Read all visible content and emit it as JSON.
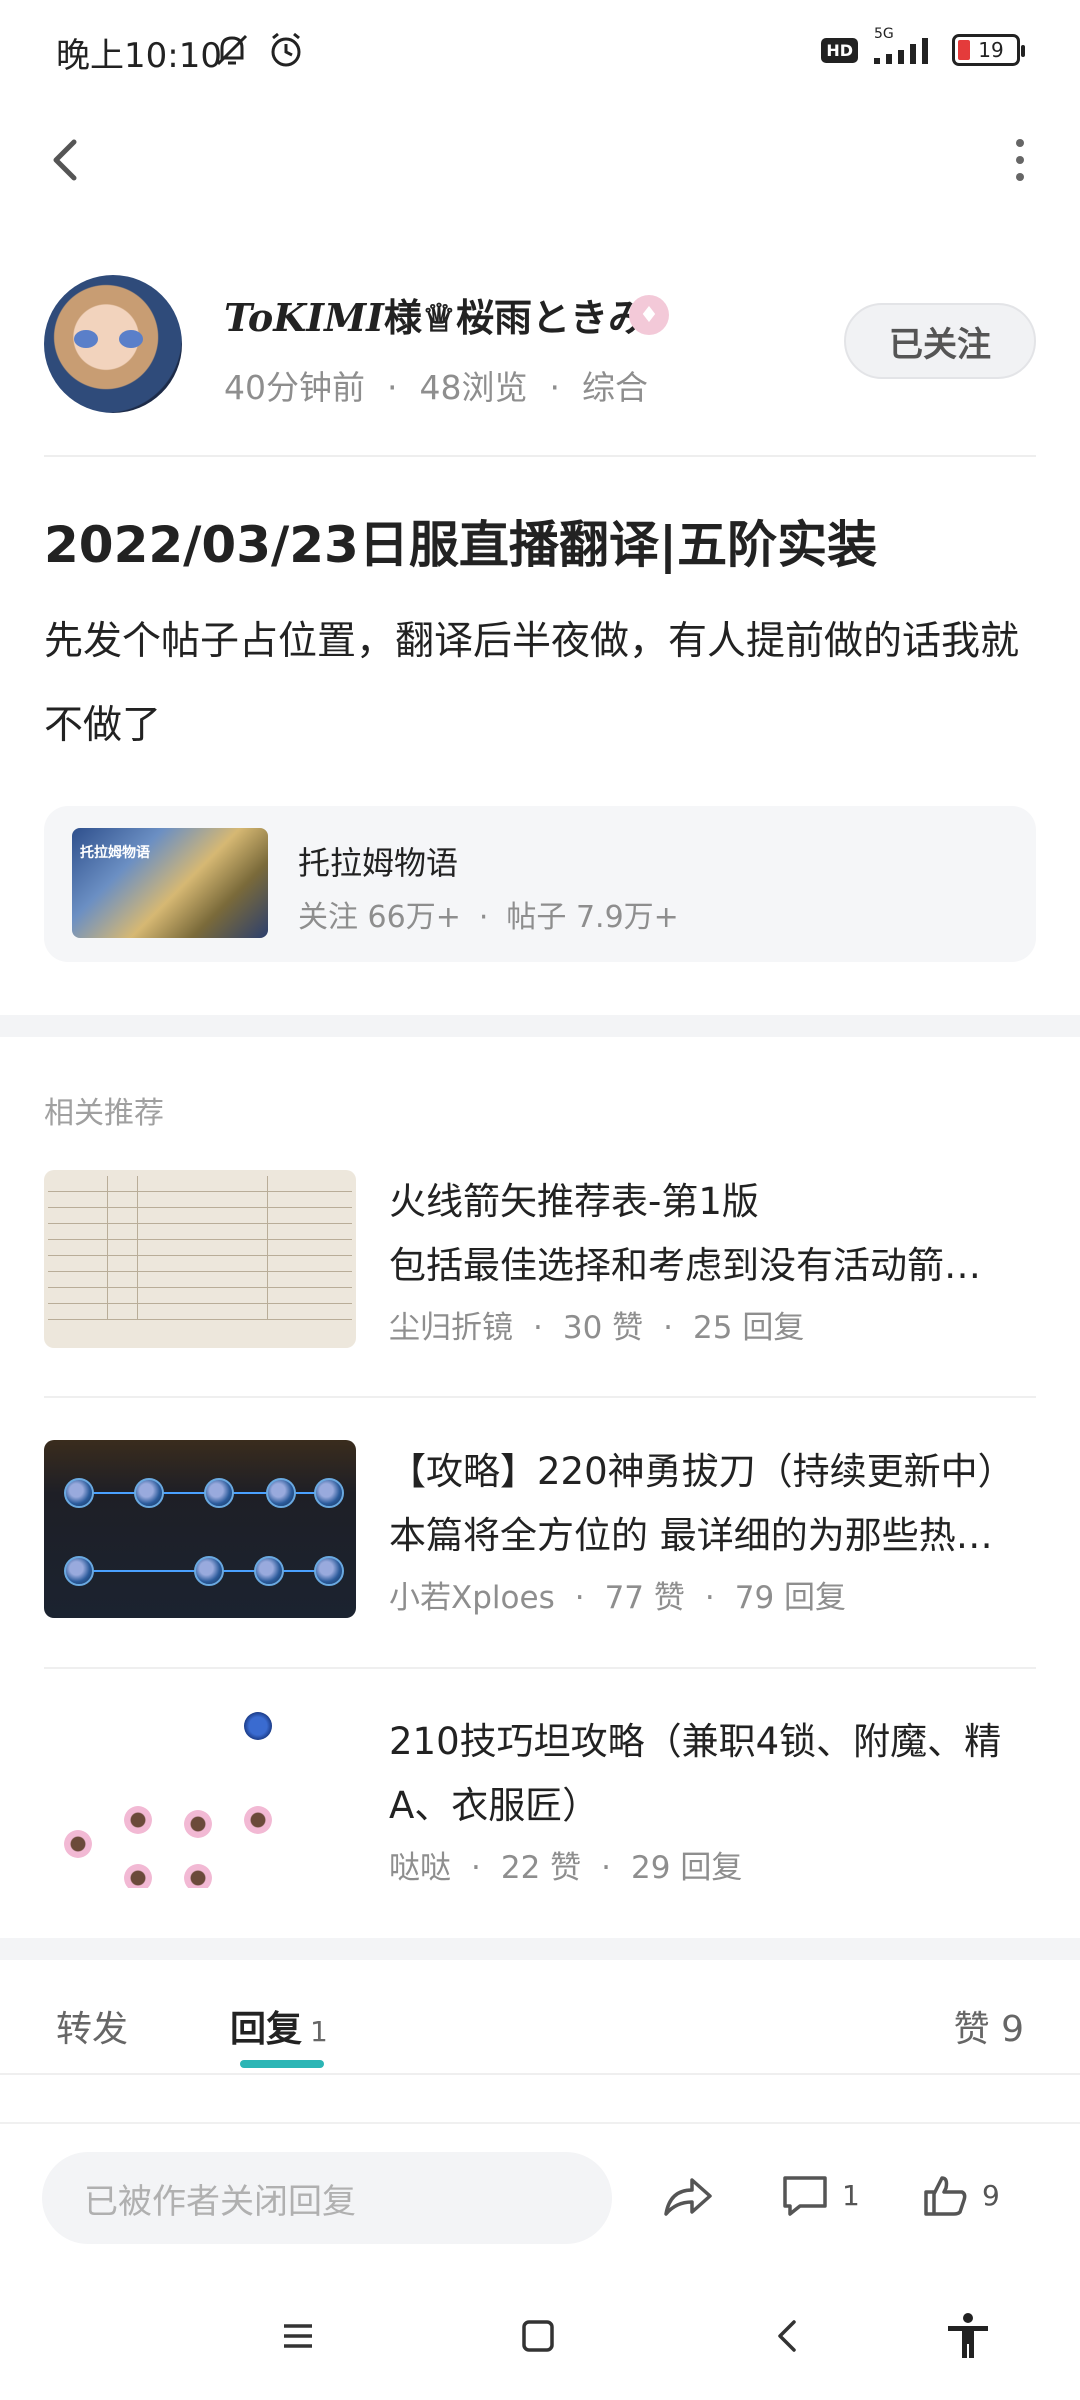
{
  "status_bar": {
    "time": "晚上10:10",
    "hd_label": "HD",
    "network_label": "5G",
    "battery": "19"
  },
  "author": {
    "name_latin": "ToKIMI",
    "name_rest": "様♕桜雨ときみ",
    "time_ago": "40分钟前",
    "views": "48浏览",
    "category": "综合",
    "follow_label": "已关注"
  },
  "post": {
    "title": "2022/03/23日服直播翻译|五阶实装",
    "body": "先发个帖子占位置，翻译后半夜做，有人提前做的话我就不做了"
  },
  "forum": {
    "name": "托拉姆物语",
    "followers": "关注 66万+",
    "posts": "帖子 7.9万+",
    "thumb_text": "托拉姆物语"
  },
  "recommendations": {
    "title": "相关推荐",
    "items": [
      {
        "line1": "火线箭矢推荐表-第1版",
        "line2": "包括最佳选择和考虑到没有活动箭…",
        "author": "尘归折镜",
        "likes": "30 赞",
        "replies": "25 回复"
      },
      {
        "line1": "【攻略】220神勇拔刀（持续更新中）",
        "line2": "本篇将全方位的 最详细的为那些热…",
        "author": "小若Xploes",
        "likes": "77 赞",
        "replies": "79 回复"
      },
      {
        "line1": "210技巧坦攻略（兼职4锁、附魔、精",
        "line2": "A、衣服匠）",
        "author": "哒哒",
        "likes": "22 赞",
        "replies": "29 回复"
      }
    ]
  },
  "tabs": {
    "forward": "转发",
    "reply": "回复",
    "reply_count": "1",
    "likes": "赞 9"
  },
  "bottom_bar": {
    "reply_placeholder": "已被作者关闭回复",
    "comment_count": "1",
    "like_count": "9"
  },
  "colors": {
    "accent": "#2cb5b5",
    "muted_text": "#8e8e8e",
    "section_bg": "#f3f4f6"
  }
}
